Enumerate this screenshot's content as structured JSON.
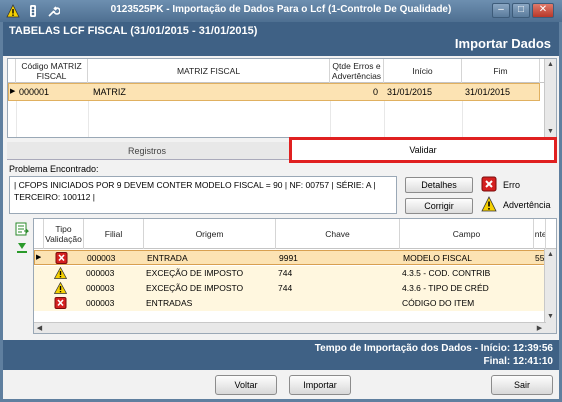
{
  "window": {
    "title": "0123525PK - Importação de Dados Para o Lcf (1-Controle De Qualidade)",
    "icons": [
      "warning-icon",
      "traffic-light-icon",
      "wrench-icon"
    ]
  },
  "header": {
    "title": "TABELAS LCF FISCAL (31/01/2015 - 31/01/2015)",
    "action": "Importar Dados"
  },
  "top_grid": {
    "columns": [
      "Código MATRIZ FISCAL",
      "MATRIZ FISCAL",
      "Qtde Erros e Advertências",
      "Início",
      "Fim"
    ],
    "rows": [
      {
        "codigo": "000001",
        "matriz": "MATRIZ",
        "qtde": "0",
        "inicio": "31/01/2015",
        "fim": "31/01/2015"
      }
    ]
  },
  "tabs": [
    {
      "label": "Registros",
      "active": false
    },
    {
      "label": "Validar",
      "active": true
    }
  ],
  "problem": {
    "label": "Problema Encontrado:",
    "line1": "| CFOPS INICIADOS POR 9 DEVEM CONTER MODELO FISCAL = 90 | NF: 00757 | SÉRIE: A |",
    "line2": "TERCEIRO: 100112 |",
    "detalhes_label": "Detalhes",
    "corrigir_label": "Corrigir"
  },
  "legend": {
    "erro": "Erro",
    "advertencia": "Advertência"
  },
  "lower_grid": {
    "columns": [
      "Tipo Validação",
      "Filial",
      "Origem",
      "Chave",
      "Campo",
      "Inte"
    ],
    "rows": [
      {
        "type": "error",
        "filial": "000003",
        "origem": "ENTRADA",
        "chave": "9991",
        "campo": "MODELO FISCAL",
        "extra": "55",
        "selected": true
      },
      {
        "type": "warning",
        "filial": "000003",
        "origem": "EXCEÇÃO DE IMPOSTO",
        "chave": "744",
        "campo": "4.3.5 - COD. CONTRIB",
        "extra": "",
        "selected": false
      },
      {
        "type": "warning",
        "filial": "000003",
        "origem": "EXCEÇÃO DE IMPOSTO",
        "chave": "744",
        "campo": "4.3.6 - TIPO DE CRÉD",
        "extra": "",
        "selected": false
      },
      {
        "type": "error",
        "filial": "000003",
        "origem": "ENTRADAS",
        "chave": "",
        "campo": "CÓDIGO DO ITEM",
        "extra": "",
        "selected": false
      }
    ]
  },
  "footer": {
    "line1": "Tempo de Importação dos Dados - Início: 12:39:56",
    "line2": "Final: 12:41:10"
  },
  "buttons": {
    "voltar": "Voltar",
    "importar": "Importar",
    "sair": "Sair"
  },
  "colors": {
    "header_bg": "#3f6185",
    "selected_row": "#fce3b3",
    "validar_border": "#e02020",
    "error_red": "#d42020",
    "warning_yellow": "#f5d000"
  }
}
